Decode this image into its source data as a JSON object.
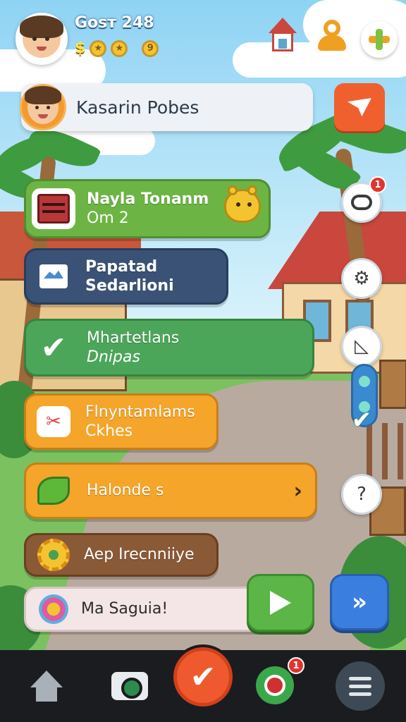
{
  "player": {
    "name": "Gosт 248",
    "currency_label": "$",
    "coin_symbol": "9"
  },
  "profile": {
    "name": "Kasarin Pobes"
  },
  "menu": {
    "cards": [
      {
        "line1": "Nayla Tonanm",
        "line2": "Om 2"
      },
      {
        "line1": "Papatad",
        "line2": "Sedarlioni"
      },
      {
        "line1": "Mhartetlans",
        "line2": "Dnipas"
      },
      {
        "line1": "Flnyntamlams",
        "line2": "Ckhes"
      },
      {
        "line1": "Halonde  s",
        "line2": ""
      },
      {
        "line1": "Aep Irecnniiye",
        "line2": ""
      },
      {
        "line1": "Ma Saguia!",
        "line2": ""
      }
    ]
  },
  "side": {
    "badge_top": "1"
  },
  "nav": {
    "chat_badge": "1"
  },
  "colors": {
    "accent_orange": "#f0602e",
    "card_green": "#6cb545",
    "card_navy": "#3a5276",
    "card_orange": "#f4a52a",
    "nav_bg": "#1a1c20"
  },
  "icons": {
    "top": [
      "avatar",
      "coin-icon",
      "house-icon",
      "person-icon",
      "puzzle-icon"
    ],
    "cards": [
      "chest-icon",
      "map-icon",
      "check-icon",
      "craft-icon",
      "leaf-icon",
      "gear-icon",
      "flower-icon"
    ],
    "side": [
      "ring-icon",
      "gear-icon",
      "flag-icon",
      "question-icon"
    ],
    "nav": [
      "home-icon",
      "camera-icon",
      "check-icon",
      "chat-icon",
      "menu-icon"
    ]
  }
}
